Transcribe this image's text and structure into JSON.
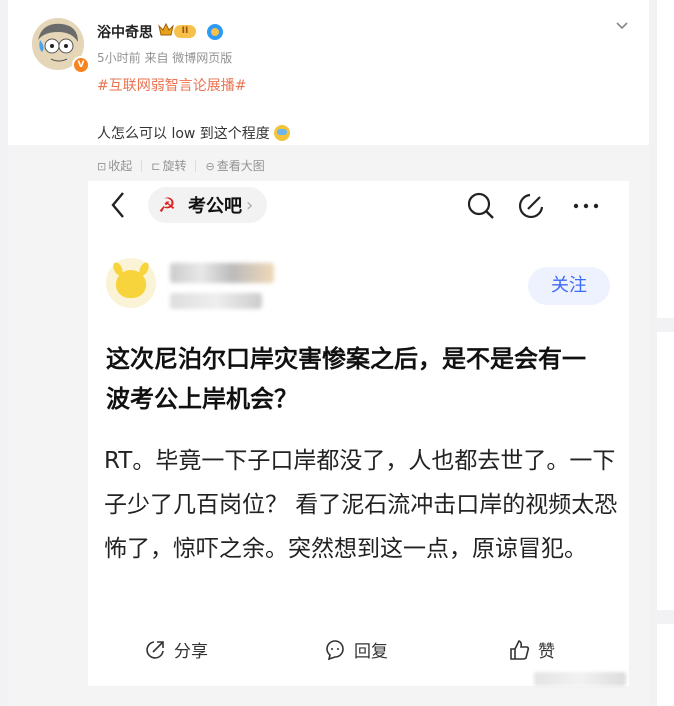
{
  "post": {
    "username": "浴中奇思",
    "level_badge": "II",
    "time": "5小时前",
    "source": "来自 微博网页版",
    "topic": "#互联网弱智言论展播#",
    "text": "人怎么可以 low 到这个程度",
    "toolbar": {
      "collapse": "收起",
      "rotate": "旋转",
      "view_large": "查看大图"
    }
  },
  "screenshot": {
    "forum_name": "考公吧",
    "follow_label": "关注",
    "title": "这次尼泊尔口岸灾害惨案之后，是不是会有一波考公上岸机会？",
    "body": "RT。毕竟一下子口岸都没了，人也都去世了。一下子少了几百岗位？ 看了泥石流冲击口岸的视频太恐怖了，惊吓之余。突然想到这一点，原谅冒犯。",
    "actions": {
      "share": "分享",
      "reply": "回复",
      "like": "赞"
    }
  },
  "icons": [
    "expand-chevron-icon",
    "crown-icon",
    "verified-icon",
    "back-arrow-icon",
    "search-icon",
    "edit-icon",
    "more-icon",
    "share-icon",
    "reply-icon",
    "like-icon"
  ],
  "colors": {
    "topic": "#eb7350",
    "follow": "#3e6bf5",
    "vip": "#f7841e"
  }
}
